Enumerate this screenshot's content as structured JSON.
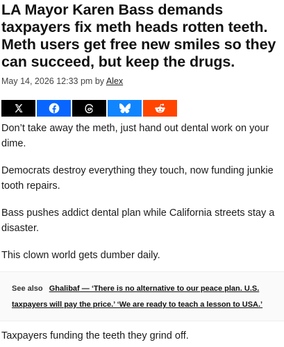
{
  "headline": "LA Mayor Karen Bass demands taxpayers fix meth heads rotten teeth. Meth users get free new smiles so they can succeed, but keep the drugs.",
  "meta": {
    "date": "May 14, 2026 12:33 pm",
    "by": "by",
    "author": "Alex"
  },
  "share": [
    {
      "name": "x",
      "color": "#000000",
      "icon": "x-logo-icon"
    },
    {
      "name": "facebook",
      "color": "#0866FF",
      "icon": "facebook-icon"
    },
    {
      "name": "threads",
      "color": "#000000",
      "icon": "threads-icon"
    },
    {
      "name": "bluesky",
      "color": "#1185FE",
      "icon": "bluesky-icon"
    },
    {
      "name": "reddit",
      "color": "#FF4500",
      "icon": "reddit-icon"
    }
  ],
  "paragraphs": [
    "Don’t take away the meth, just hand out dental work on your dime.",
    "Democrats destroy everything they touch, now funding junkie tooth repairs.",
    "Bass pushes addict dental plan while California streets stay a disaster.",
    "This clown world gets dumber daily."
  ],
  "see_also": {
    "label": "See also",
    "link_text": "Ghalibaf — ‘There is no alternative to our peace plan. U.S. taxpayers will pay the price.’ ‘We are ready to teach a lesson to USA.’"
  },
  "after_paragraph": "Taxpayers funding the teeth they grind off."
}
